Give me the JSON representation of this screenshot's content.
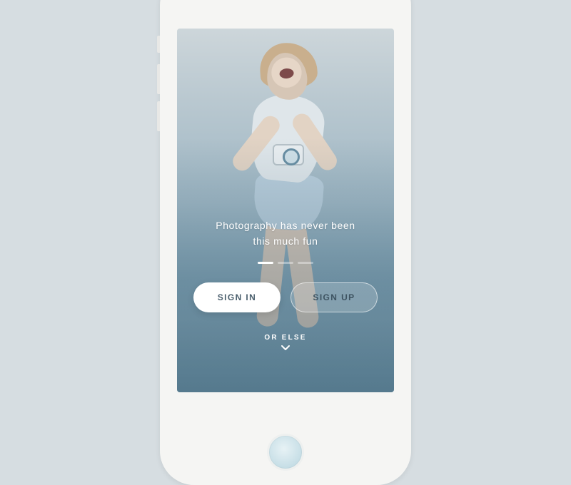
{
  "tagline_line1": "Photography has never been",
  "tagline_line2": "this much fun",
  "pager": {
    "count": 3,
    "active": 0
  },
  "buttons": {
    "signin": "SIGN IN",
    "signup": "SIGN UP"
  },
  "orelse_label": "OR ELSE",
  "icons": {
    "chevron_down": "chevron-down-icon"
  }
}
